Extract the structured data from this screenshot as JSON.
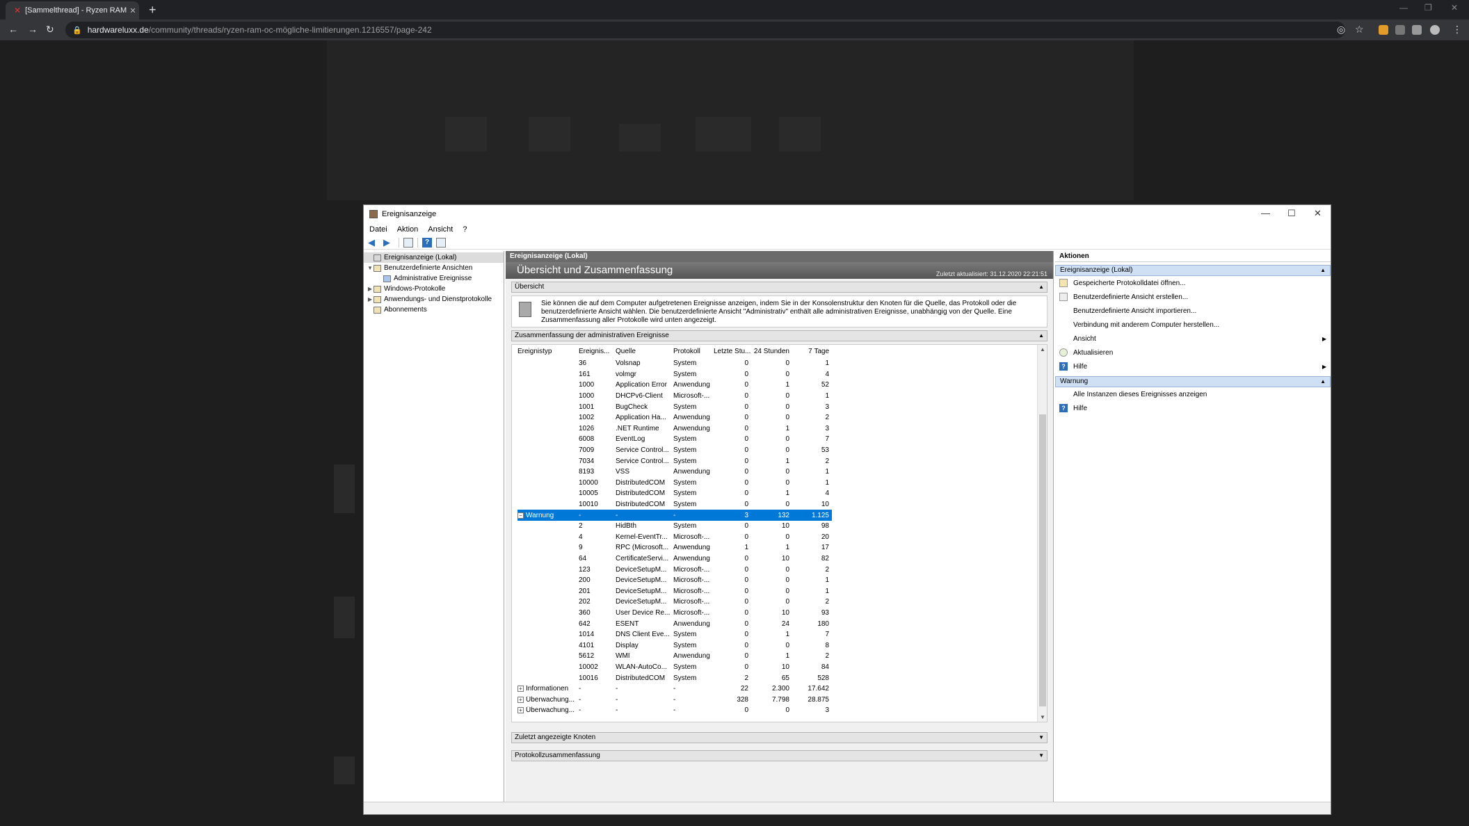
{
  "browser": {
    "tab_title": "[Sammelthread] - Ryzen RAM OC",
    "url_host": "hardwareluxx.de",
    "url_path": "/community/threads/ryzen-ram-oc-mögliche-limitierungen.1216557/page-242"
  },
  "window": {
    "title": "Ereignisanzeige",
    "menu": [
      "Datei",
      "Aktion",
      "Ansicht",
      "?"
    ]
  },
  "tree": [
    {
      "label": "Ereignisanzeige (Lokal)",
      "level": 0,
      "twist": "",
      "selected": true
    },
    {
      "label": "Benutzerdefinierte Ansichten",
      "level": 0,
      "twist": "v",
      "selected": false
    },
    {
      "label": "Administrative Ereignisse",
      "level": 1,
      "twist": "",
      "selected": false
    },
    {
      "label": "Windows-Protokolle",
      "level": 0,
      "twist": ">",
      "selected": false
    },
    {
      "label": "Anwendungs- und Dienstprotokolle",
      "level": 0,
      "twist": ">",
      "selected": false
    },
    {
      "label": "Abonnements",
      "level": 0,
      "twist": "",
      "selected": false
    }
  ],
  "middle": {
    "header": "Ereignisanzeige (Lokal)",
    "banner_title": "Übersicht und Zusammenfassung",
    "banner_updated": "Zuletzt aktualisiert: 31.12.2020 22:21:51",
    "overview_title": "Übersicht",
    "overview_text": "Sie können die auf dem Computer aufgetretenen Ereignisse anzeigen, indem Sie in der Konsolenstruktur den Knoten für die Quelle, das Protokoll oder die benutzerdefinierte Ansicht wählen. Die benutzerdefinierte Ansicht \"Administrativ\" enthält alle administrativen Ereignisse, unabhängig von der Quelle. Eine Zusammenfassung aller Protokolle wird unten angezeigt.",
    "summary_title": "Zusammenfassung der administrativen Ereignisse",
    "recent_title": "Zuletzt angezeigte Knoten",
    "protocol_title": "Protokollzusammenfassung",
    "columns": [
      "Ereignistyp",
      "Ereignis...",
      "Quelle",
      "Protokoll",
      "Letzte Stu...",
      "24 Stunden",
      "7 Tage"
    ]
  },
  "rows": [
    {
      "type": "",
      "id": "36",
      "source": "Volsnap",
      "log": "System",
      "h": "0",
      "d": "0",
      "w": "1"
    },
    {
      "type": "",
      "id": "161",
      "source": "volmgr",
      "log": "System",
      "h": "0",
      "d": "0",
      "w": "4"
    },
    {
      "type": "",
      "id": "1000",
      "source": "Application Error",
      "log": "Anwendung",
      "h": "0",
      "d": "1",
      "w": "52"
    },
    {
      "type": "",
      "id": "1000",
      "source": "DHCPv6-Client",
      "log": "Microsoft-...",
      "h": "0",
      "d": "0",
      "w": "1"
    },
    {
      "type": "",
      "id": "1001",
      "source": "BugCheck",
      "log": "System",
      "h": "0",
      "d": "0",
      "w": "3"
    },
    {
      "type": "",
      "id": "1002",
      "source": "Application Ha...",
      "log": "Anwendung",
      "h": "0",
      "d": "0",
      "w": "2"
    },
    {
      "type": "",
      "id": "1026",
      "source": ".NET Runtime",
      "log": "Anwendung",
      "h": "0",
      "d": "1",
      "w": "3"
    },
    {
      "type": "",
      "id": "6008",
      "source": "EventLog",
      "log": "System",
      "h": "0",
      "d": "0",
      "w": "7"
    },
    {
      "type": "",
      "id": "7009",
      "source": "Service Control...",
      "log": "System",
      "h": "0",
      "d": "0",
      "w": "53"
    },
    {
      "type": "",
      "id": "7034",
      "source": "Service Control...",
      "log": "System",
      "h": "0",
      "d": "1",
      "w": "2"
    },
    {
      "type": "",
      "id": "8193",
      "source": "VSS",
      "log": "Anwendung",
      "h": "0",
      "d": "0",
      "w": "1"
    },
    {
      "type": "",
      "id": "10000",
      "source": "DistributedCOM",
      "log": "System",
      "h": "0",
      "d": "0",
      "w": "1"
    },
    {
      "type": "",
      "id": "10005",
      "source": "DistributedCOM",
      "log": "System",
      "h": "0",
      "d": "1",
      "w": "4"
    },
    {
      "type": "",
      "id": "10010",
      "source": "DistributedCOM",
      "log": "System",
      "h": "0",
      "d": "0",
      "w": "10"
    },
    {
      "type": "Warnung",
      "id": "-",
      "source": "-",
      "log": "-",
      "h": "3",
      "d": "132",
      "w": "1.125",
      "group": "minus",
      "selected": true
    },
    {
      "type": "",
      "id": "2",
      "source": "HidBth",
      "log": "System",
      "h": "0",
      "d": "10",
      "w": "98"
    },
    {
      "type": "",
      "id": "4",
      "source": "Kernel-EventTr...",
      "log": "Microsoft-...",
      "h": "0",
      "d": "0",
      "w": "20"
    },
    {
      "type": "",
      "id": "9",
      "source": "RPC (Microsoft...",
      "log": "Anwendung",
      "h": "1",
      "d": "1",
      "w": "17"
    },
    {
      "type": "",
      "id": "64",
      "source": "CertificateServi...",
      "log": "Anwendung",
      "h": "0",
      "d": "10",
      "w": "82"
    },
    {
      "type": "",
      "id": "123",
      "source": "DeviceSetupM...",
      "log": "Microsoft-...",
      "h": "0",
      "d": "0",
      "w": "2"
    },
    {
      "type": "",
      "id": "200",
      "source": "DeviceSetupM...",
      "log": "Microsoft-...",
      "h": "0",
      "d": "0",
      "w": "1"
    },
    {
      "type": "",
      "id": "201",
      "source": "DeviceSetupM...",
      "log": "Microsoft-...",
      "h": "0",
      "d": "0",
      "w": "1"
    },
    {
      "type": "",
      "id": "202",
      "source": "DeviceSetupM...",
      "log": "Microsoft-...",
      "h": "0",
      "d": "0",
      "w": "2"
    },
    {
      "type": "",
      "id": "360",
      "source": "User Device Re...",
      "log": "Microsoft-...",
      "h": "0",
      "d": "10",
      "w": "93"
    },
    {
      "type": "",
      "id": "642",
      "source": "ESENT",
      "log": "Anwendung",
      "h": "0",
      "d": "24",
      "w": "180"
    },
    {
      "type": "",
      "id": "1014",
      "source": "DNS Client Eve...",
      "log": "System",
      "h": "0",
      "d": "1",
      "w": "7"
    },
    {
      "type": "",
      "id": "4101",
      "source": "Display",
      "log": "System",
      "h": "0",
      "d": "0",
      "w": "8"
    },
    {
      "type": "",
      "id": "5612",
      "source": "WMI",
      "log": "Anwendung",
      "h": "0",
      "d": "1",
      "w": "2"
    },
    {
      "type": "",
      "id": "10002",
      "source": "WLAN-AutoCo...",
      "log": "System",
      "h": "0",
      "d": "10",
      "w": "84"
    },
    {
      "type": "",
      "id": "10016",
      "source": "DistributedCOM",
      "log": "System",
      "h": "2",
      "d": "65",
      "w": "528"
    },
    {
      "type": "Informationen",
      "id": "-",
      "source": "-",
      "log": "-",
      "h": "22",
      "d": "2.300",
      "w": "17.642",
      "group": "plus"
    },
    {
      "type": "Überwachung...",
      "id": "-",
      "source": "-",
      "log": "-",
      "h": "328",
      "d": "7.798",
      "w": "28.875",
      "group": "plus"
    },
    {
      "type": "Überwachung...",
      "id": "-",
      "source": "-",
      "log": "-",
      "h": "0",
      "d": "0",
      "w": "3",
      "group": "plus"
    }
  ],
  "actions": {
    "header": "Aktionen",
    "group1": "Ereignisanzeige (Lokal)",
    "items1": [
      {
        "label": "Gespeicherte Protokolldatei öffnen...",
        "icon": "open"
      },
      {
        "label": "Benutzerdefinierte Ansicht erstellen...",
        "icon": "filter"
      },
      {
        "label": "Benutzerdefinierte Ansicht importieren...",
        "icon": "blank"
      },
      {
        "label": "Verbindung mit anderem Computer herstellen...",
        "icon": "blank"
      },
      {
        "label": "Ansicht",
        "icon": "blank",
        "sub": true
      },
      {
        "label": "Aktualisieren",
        "icon": "refresh"
      },
      {
        "label": "Hilfe",
        "icon": "help",
        "sub": true
      }
    ],
    "group2": "Warnung",
    "items2": [
      {
        "label": "Alle Instanzen dieses Ereignisses anzeigen",
        "icon": "blank"
      },
      {
        "label": "Hilfe",
        "icon": "help"
      }
    ]
  }
}
